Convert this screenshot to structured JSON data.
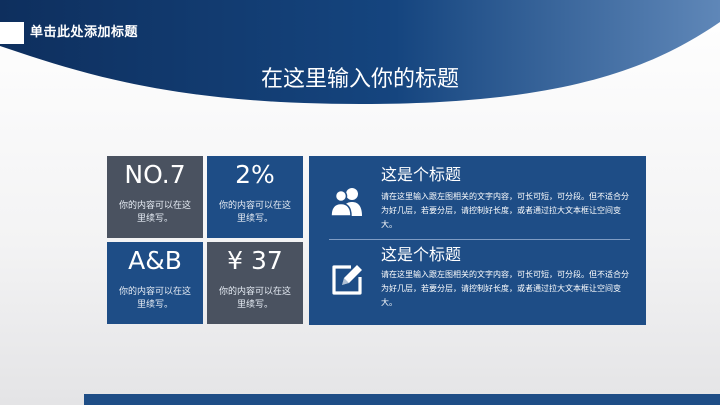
{
  "header": {
    "label": "单击此处添加标题",
    "main_title": "在这里输入你的标题"
  },
  "colors": {
    "primary_blue": "#1e4d86",
    "tile_gray": "#4a5260",
    "header_dark": "#0e2f5e"
  },
  "tiles": [
    {
      "value": "NO.7",
      "desc": "你的内容可以在这里续写。"
    },
    {
      "value": "2%",
      "desc": "你的内容可以在这里续写。"
    },
    {
      "value": "A&B",
      "desc": "你的内容可以在这里续写。"
    },
    {
      "value": "¥ 37",
      "desc": "你的内容可以在这里续写。"
    }
  ],
  "panel": {
    "items": [
      {
        "icon": "users-icon",
        "title": "这是个标题",
        "body": "请在这里输入跟左图相关的文字内容，可长可短，可分段。但不适合分为好几层，若要分层，请控制好长度，或者通过拉大文本框让空间变大。"
      },
      {
        "icon": "edit-icon",
        "title": "这是个标题",
        "body": "请在这里输入跟左图相关的文字内容，可长可短，可分段。但不适合分为好几层，若要分层，请控制好长度，或者通过拉大文本框让空间变大。"
      }
    ]
  }
}
